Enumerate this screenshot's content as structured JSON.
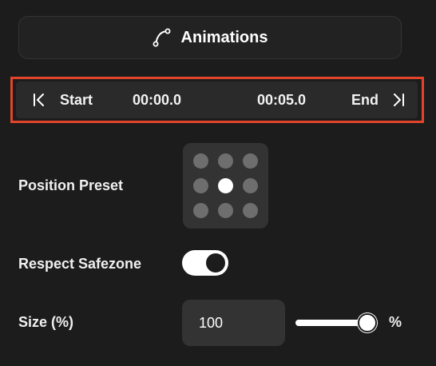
{
  "animations_button": {
    "label": "Animations",
    "icon": "bezier-curve-icon"
  },
  "timeline": {
    "start_label": "Start",
    "start_time": "00:00.0",
    "end_time": "00:05.0",
    "end_label": "End",
    "start_icon": "skip-to-start-icon",
    "end_icon": "skip-to-end-icon",
    "highlight_color": "#e0452c"
  },
  "position_preset": {
    "label": "Position Preset",
    "selected": "center",
    "options": [
      "top-left",
      "top-center",
      "top-right",
      "middle-left",
      "center",
      "middle-right",
      "bottom-left",
      "bottom-center",
      "bottom-right"
    ]
  },
  "respect_safezone": {
    "label": "Respect Safezone",
    "enabled": true
  },
  "size": {
    "label": "Size (%)",
    "value": "100",
    "slider_percent": 100,
    "unit": "%"
  }
}
